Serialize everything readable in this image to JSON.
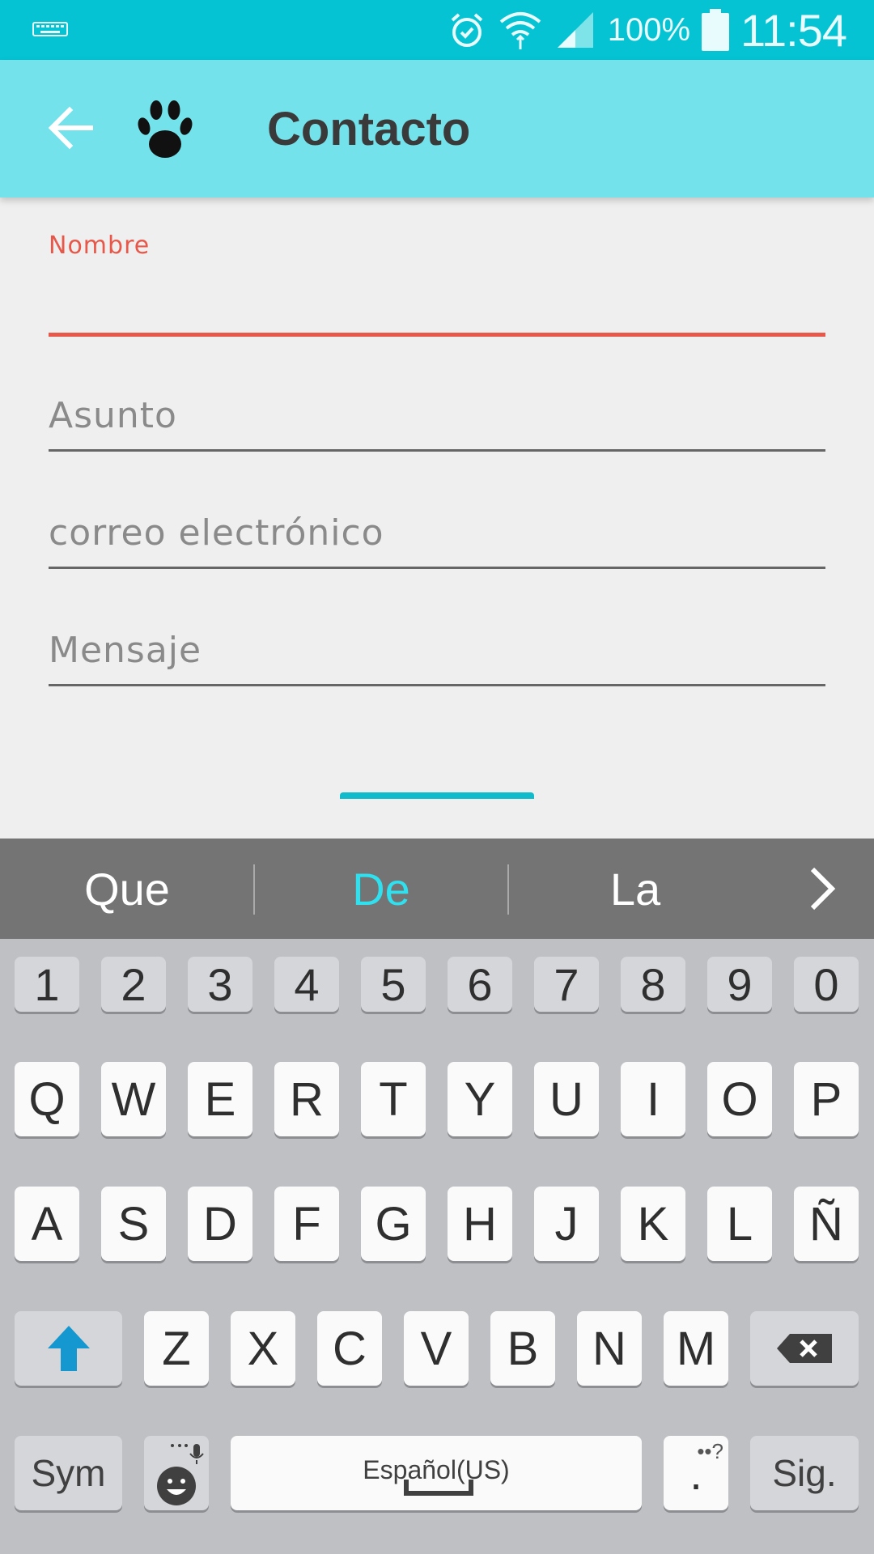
{
  "status_bar": {
    "battery": "100%",
    "time": "11:54"
  },
  "app_bar": {
    "title": "Contacto"
  },
  "form": {
    "nombre_label": "Nombre",
    "asunto_placeholder": "Asunto",
    "correo_placeholder": "correo electrónico",
    "mensaje_placeholder": "Mensaje"
  },
  "keyboard": {
    "suggestions": [
      "Que",
      "De",
      "La"
    ],
    "number_row": [
      "1",
      "2",
      "3",
      "4",
      "5",
      "6",
      "7",
      "8",
      "9",
      "0"
    ],
    "row1": [
      "Q",
      "W",
      "E",
      "R",
      "T",
      "Y",
      "U",
      "I",
      "O",
      "P"
    ],
    "row2": [
      "A",
      "S",
      "D",
      "F",
      "G",
      "H",
      "J",
      "K",
      "L",
      "Ñ"
    ],
    "row3": [
      "Z",
      "X",
      "C",
      "V",
      "B",
      "N",
      "M"
    ],
    "sym_label": "Sym",
    "space_label": "Español(US)",
    "punct_hint": "••?",
    "punct_label": ".",
    "next_label": "Sig."
  },
  "colors": {
    "status_bar": "#05c3d3",
    "app_bar": "#74e2ea",
    "error_accent": "#e8584a",
    "suggestion_highlight": "#2fe0ee"
  }
}
